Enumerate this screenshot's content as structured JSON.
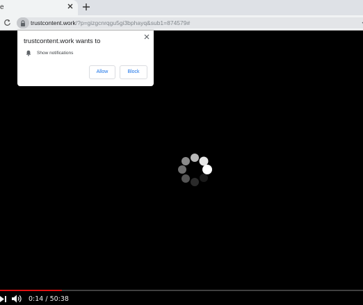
{
  "browser": {
    "tab_title": "e",
    "url_host": "trustcontent.work",
    "url_path": "/?p=gizgcnrqgu5gi3bphayq&sub1=874579#"
  },
  "notification_prompt": {
    "title": "trustcontent.work wants to",
    "permission_label": "Show notifications",
    "allow_label": "Allow",
    "block_label": "Block"
  },
  "video": {
    "time_display": "0:14 / 50:38",
    "progress_fraction": 0.17,
    "progress_color": "#e11111"
  },
  "colors": {
    "accent_blue": "#1a73e8",
    "page_background": "#000000"
  },
  "icons": [
    "close-icon",
    "new-tab-icon",
    "reload-icon",
    "lock-icon",
    "chevron-down-icon",
    "bell-icon",
    "loading-spinner-icon",
    "skip-next-icon",
    "volume-icon"
  ]
}
